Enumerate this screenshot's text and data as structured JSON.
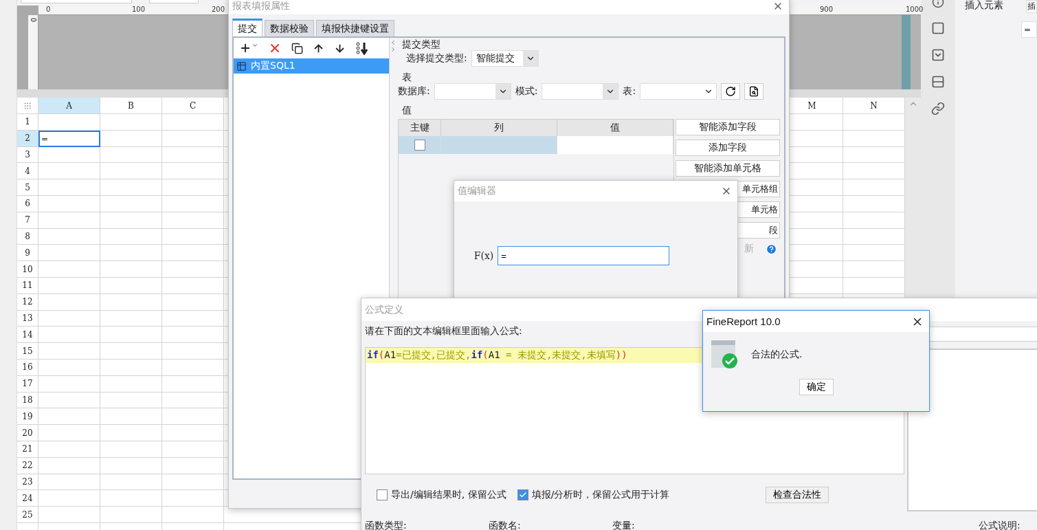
{
  "app": {
    "ruler": {
      "labels": [
        "0",
        "100",
        "200",
        "900",
        "1000"
      ],
      "side_label": "0"
    },
    "spreadsheet": {
      "columns": [
        {
          "label": "A",
          "selected": true
        },
        {
          "label": "B",
          "selected": false
        },
        {
          "label": "C",
          "selected": false
        },
        {
          "label": "M",
          "selected": false
        },
        {
          "label": "N",
          "selected": false
        }
      ],
      "rows": [
        {
          "label": "1",
          "selected": false
        },
        {
          "label": "2",
          "selected": true
        },
        {
          "label": "3",
          "selected": false
        },
        {
          "label": "4",
          "selected": false
        },
        {
          "label": "5",
          "selected": false
        },
        {
          "label": "6",
          "selected": false
        },
        {
          "label": "7",
          "selected": false
        },
        {
          "label": "8",
          "selected": false
        },
        {
          "label": "9",
          "selected": false
        },
        {
          "label": "10",
          "selected": false
        },
        {
          "label": "11",
          "selected": false
        },
        {
          "label": "12",
          "selected": false
        },
        {
          "label": "13",
          "selected": false
        },
        {
          "label": "14",
          "selected": false
        },
        {
          "label": "15",
          "selected": false
        },
        {
          "label": "16",
          "selected": false
        },
        {
          "label": "17",
          "selected": false
        },
        {
          "label": "18",
          "selected": false
        },
        {
          "label": "19",
          "selected": false
        },
        {
          "label": "20",
          "selected": false
        },
        {
          "label": "21",
          "selected": false
        },
        {
          "label": "22",
          "selected": false
        },
        {
          "label": "23",
          "selected": false
        },
        {
          "label": "24",
          "selected": false
        },
        {
          "label": "25",
          "selected": false
        }
      ],
      "active_cell_value": "="
    },
    "insert_panel": {
      "title": "插入元素",
      "cut_label": "插",
      "field_value": "="
    }
  },
  "fill_properties_dialog": {
    "title": "报表填报属性",
    "tabs": [
      {
        "label": "提交",
        "selected": true
      },
      {
        "label": "数据校验",
        "selected": false
      },
      {
        "label": "填报快捷键设置",
        "selected": false
      }
    ],
    "submissions": [
      {
        "label": "内置SQL1",
        "selected": true
      }
    ],
    "submit_type": {
      "section": "提交类型",
      "label": "选择提交类型:",
      "value": "智能提交"
    },
    "table_section": {
      "section": "表",
      "fields": [
        {
          "label": "数据库:"
        },
        {
          "label": "模式:"
        },
        {
          "label": "表:"
        }
      ]
    },
    "value_section": {
      "section": "值",
      "columns": [
        "主键",
        "列",
        "值"
      ],
      "rows": [
        {
          "checked": false,
          "selected": true
        }
      ]
    },
    "buttons": [
      "智能添加字段",
      "添加字段",
      "智能添加单元格",
      "单元格组",
      "单元格",
      "段"
    ],
    "cut_link": "新"
  },
  "value_editor": {
    "title": "值编辑器",
    "formula_icon": "F(x)",
    "value": "="
  },
  "formula_dialog": {
    "title": "公式定义",
    "prompt": "请在下面的文本编辑框里面输入公式:",
    "formula": [
      {
        "kind": "keyword",
        "text": "if"
      },
      {
        "kind": "paren",
        "text": "("
      },
      {
        "kind": "ref",
        "text": "A1"
      },
      {
        "kind": "text",
        "text": "=已提交,已提交,"
      },
      {
        "kind": "keyword",
        "text": "if"
      },
      {
        "kind": "paren",
        "text": "("
      },
      {
        "kind": "ref",
        "text": "A1"
      },
      {
        "kind": "text",
        "text": " = 未提交,未提交,未填写"
      },
      {
        "kind": "paren",
        "text": "))"
      }
    ],
    "options": [
      {
        "label": "导出/编辑结果时, 保留公式",
        "checked": false
      },
      {
        "label": "填报/分析时，保留公式用于计算",
        "checked": true
      }
    ],
    "check_button": "检查合法性",
    "panels": [
      "函数类型:",
      "函数名:",
      "变量:"
    ],
    "description_label": "公式说明:"
  },
  "message_dialog": {
    "title": "FineReport 10.0",
    "message": "合法的公式.",
    "ok_button": "确定"
  }
}
